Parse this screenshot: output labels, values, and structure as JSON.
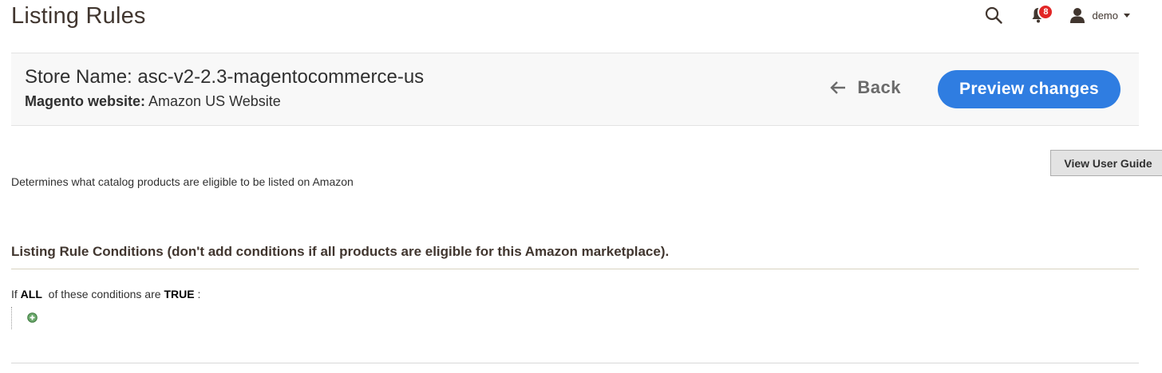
{
  "page": {
    "title": "Listing Rules"
  },
  "header": {
    "search_icon": "search-icon",
    "notifications": {
      "icon": "bell-icon",
      "count": "8",
      "badge_color": "#e22626"
    },
    "user": {
      "icon": "user-icon",
      "name": "demo"
    }
  },
  "store": {
    "name_line": "Store Name: asc-v2-2.3-magentocommerce-us",
    "website_label": "Magento website:",
    "website_value": "Amazon US Website"
  },
  "actions": {
    "back_label": "Back",
    "preview_label": "Preview changes",
    "accent_color": "#2f7de1"
  },
  "guide": {
    "label": "View User Guide"
  },
  "description": "Determines what catalog products are eligible to be listed on Amazon",
  "conditions": {
    "section_title": "Listing Rule Conditions (don't add conditions if all products are eligible for this Amazon marketplace).",
    "prefix": "If",
    "aggregator": "ALL",
    "middle": "of these conditions are",
    "value": "TRUE",
    "suffix": ":",
    "add_icon": "add-condition-icon"
  }
}
